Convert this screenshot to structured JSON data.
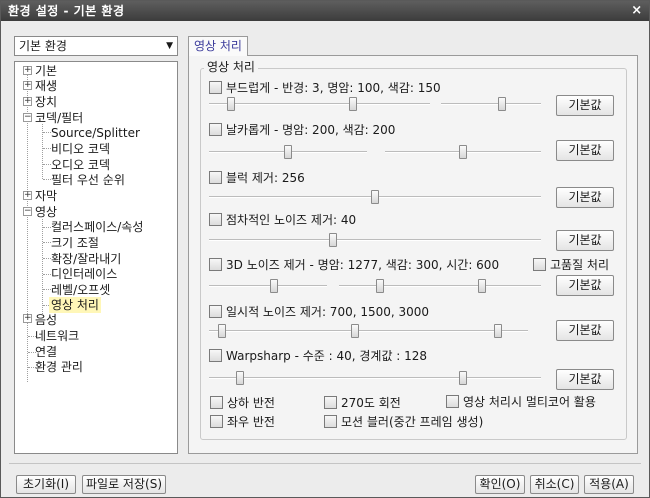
{
  "window": {
    "title": "환경 설정 - 기본 환경",
    "close_glyph": "×"
  },
  "category_select": {
    "value": "기본 환경"
  },
  "tree": {
    "items": [
      {
        "label": "기본",
        "expander": "+"
      },
      {
        "label": "재생",
        "expander": "+"
      },
      {
        "label": "장치",
        "expander": "+"
      },
      {
        "label": "코덱/필터",
        "expander": "−"
      },
      {
        "label": "Source/Splitter"
      },
      {
        "label": "비디오 코덱"
      },
      {
        "label": "오디오 코덱"
      },
      {
        "label": "필터 우선 순위"
      },
      {
        "label": "자막",
        "expander": "+"
      },
      {
        "label": "영상",
        "expander": "−"
      },
      {
        "label": "컬러스페이스/속성"
      },
      {
        "label": "크기 조절"
      },
      {
        "label": "확장/잘라내기"
      },
      {
        "label": "디인터레이스"
      },
      {
        "label": "레벨/오프셋"
      },
      {
        "label": "영상 처리",
        "selected": true
      },
      {
        "label": "음성",
        "expander": "+"
      },
      {
        "label": "네트워크"
      },
      {
        "label": "연결"
      },
      {
        "label": "환경 관리"
      }
    ]
  },
  "tab": {
    "label": "영상 처리"
  },
  "group": {
    "title": "영상 처리"
  },
  "settings": {
    "smooth": {
      "label": "부드럽게 - 반경: 3, 명암: 100, 색감: 150",
      "sliders": [
        0.12,
        0.5,
        0.62
      ]
    },
    "sharpen": {
      "label": "날카롭게 - 명암: 200, 색감: 200",
      "sliders": [
        0.5,
        0.5
      ]
    },
    "block": {
      "label": "블럭 제거: 256",
      "sliders": [
        0.5
      ]
    },
    "gradual_noise": {
      "label": "점차적인 노이즈 제거: 40",
      "sliders": [
        0.37
      ]
    },
    "noise3d": {
      "label": "3D 노이즈 제거 - 명암: 1277, 색감: 300, 시간: 600",
      "hq_label": "고품질 처리",
      "sliders": [
        0.55,
        0.4,
        0.53
      ]
    },
    "temporal": {
      "label": "일시적 노이즈 제거: 700, 1500, 3000",
      "sliders": [
        0.08,
        0.45,
        0.78
      ]
    },
    "warpsharp": {
      "label": "Warpsharp - 수준 : 40, 경계값 : 128",
      "sliders": [
        0.15,
        0.5
      ]
    }
  },
  "default_button_label": "기본값",
  "options": {
    "flip_v": "상하 반전",
    "rotate270": "270도 회전",
    "multicore": "영상 처리시 멀티코어 활용",
    "flip_h": "좌우 반전",
    "motion_blur": "모션 블러(중간 프레임 생성)"
  },
  "bottom": {
    "reset": "초기화(I)",
    "save_file": "파일로 저장(S)",
    "ok": "확인(O)",
    "cancel": "취소(C)",
    "apply": "적용(A)"
  }
}
